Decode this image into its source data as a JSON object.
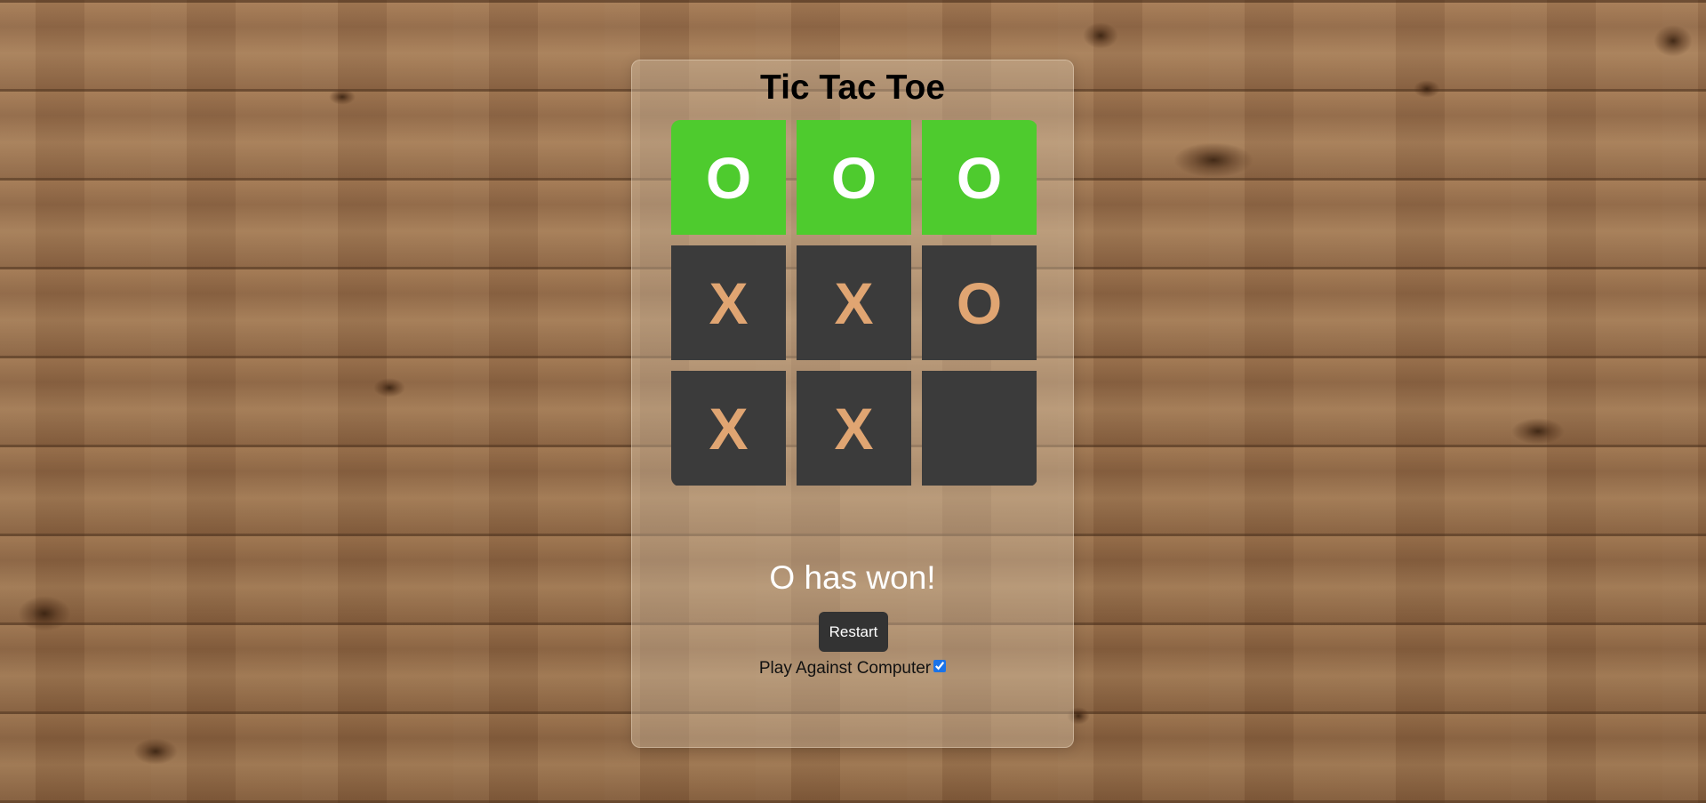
{
  "game": {
    "title": "Tic Tac Toe",
    "board": [
      {
        "mark": "O",
        "winning": true
      },
      {
        "mark": "O",
        "winning": true
      },
      {
        "mark": "O",
        "winning": true
      },
      {
        "mark": "X",
        "winning": false
      },
      {
        "mark": "X",
        "winning": false
      },
      {
        "mark": "O",
        "winning": false
      },
      {
        "mark": "X",
        "winning": false
      },
      {
        "mark": "X",
        "winning": false
      },
      {
        "mark": "",
        "winning": false
      }
    ],
    "status": "O has won!",
    "restart_label": "Restart",
    "computer_label": "Play Against Computer",
    "computer_checked": true
  },
  "colors": {
    "cell_bg": "#3b3b3b",
    "win_bg": "#4ecb2e",
    "mark": "#e0a572",
    "win_mark": "#ffffff"
  }
}
